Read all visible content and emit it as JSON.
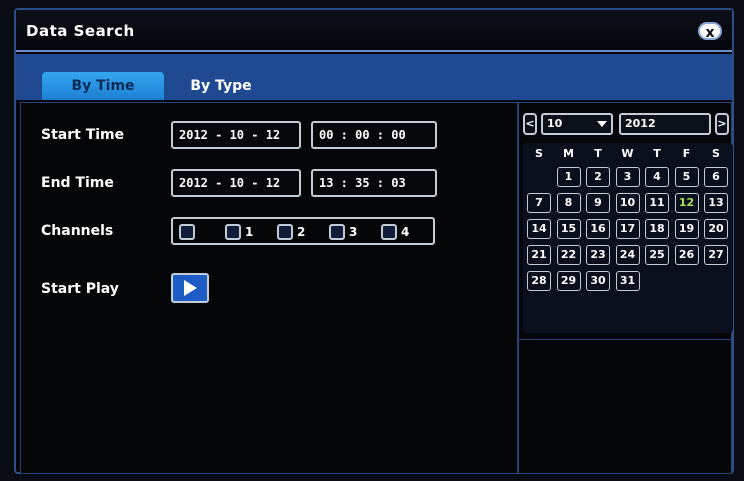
{
  "window": {
    "title": "Data Search",
    "close_symbol": "x"
  },
  "tabs": [
    {
      "label": "By Time",
      "active": true
    },
    {
      "label": "By Type",
      "active": false
    }
  ],
  "form": {
    "start_time_label": "Start Time",
    "start_date": "2012 - 10 - 12",
    "start_clock": "00 : 00 : 00",
    "end_time_label": "End Time",
    "end_date": "2012 - 10 - 12",
    "end_clock": "13 : 35 : 03",
    "channels_label": "Channels",
    "channels": [
      "",
      "1",
      "2",
      "3",
      "4"
    ],
    "start_play_label": "Start Play"
  },
  "calendar": {
    "prev": "<",
    "next": ">",
    "month": "10",
    "year": "2012",
    "weekdays": [
      "S",
      "M",
      "T",
      "W",
      "T",
      "F",
      "S"
    ],
    "days": [
      "1",
      "2",
      "3",
      "4",
      "5",
      "6",
      "7",
      "8",
      "9",
      "10",
      "11",
      "12",
      "13",
      "14",
      "15",
      "16",
      "17",
      "18",
      "19",
      "20",
      "21",
      "22",
      "23",
      "24",
      "25",
      "26",
      "27",
      "28",
      "29",
      "30",
      "31"
    ],
    "first_weekday_index": 1,
    "highlight_day": "12"
  },
  "colors": {
    "accent": "#1f4a92",
    "tab_active": "#2ea0ee",
    "highlight_day": "#a4e05a"
  }
}
